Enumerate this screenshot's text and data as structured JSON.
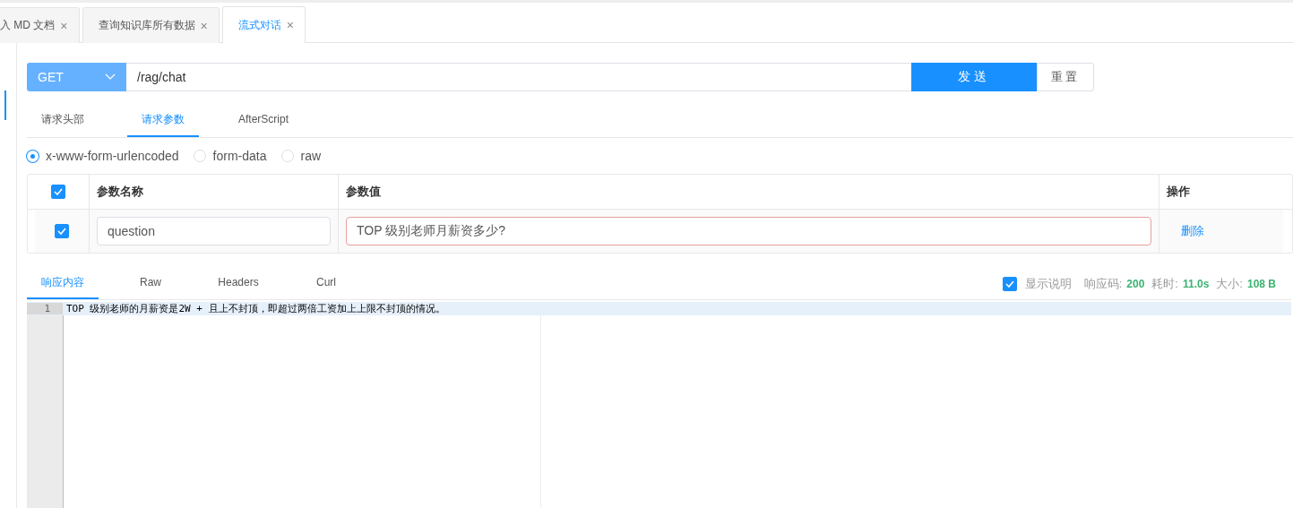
{
  "tabs": [
    {
      "label": "入 MD 文档",
      "close": "×",
      "selected": false
    },
    {
      "label": "查询知识库所有数据",
      "close": "×",
      "selected": false
    },
    {
      "label": "流式对话",
      "close": "×",
      "selected": true
    }
  ],
  "request": {
    "method": "GET",
    "url": "/rag/chat",
    "send": "发送",
    "reset": "重置"
  },
  "request_tabs": [
    {
      "label": "请求头部",
      "selected": false
    },
    {
      "label": "请求参数",
      "selected": true
    },
    {
      "label": "AfterScript",
      "selected": false
    }
  ],
  "body_types": [
    {
      "label": "x-www-form-urlencoded",
      "selected": true
    },
    {
      "label": "form-data",
      "selected": false
    },
    {
      "label": "raw",
      "selected": false
    }
  ],
  "params_table": {
    "header_checked": true,
    "columns": [
      "参数名称",
      "参数值",
      "操作"
    ],
    "rows": [
      {
        "checked": true,
        "name": "question",
        "value": "TOP 级别老师月薪资多少?",
        "action": "删除"
      }
    ]
  },
  "response_tabs": [
    {
      "label": "响应内容",
      "selected": true
    },
    {
      "label": "Raw",
      "selected": false
    },
    {
      "label": "Headers",
      "selected": false
    },
    {
      "label": "Curl",
      "selected": false
    }
  ],
  "show_description": {
    "label": "显示说明",
    "checked": true
  },
  "stats": [
    {
      "label": "响应码:",
      "value": "200"
    },
    {
      "label": "耗时:",
      "value": "11.0s"
    },
    {
      "label": "大小:",
      "value": "108 B"
    }
  ],
  "editor": {
    "lines": [
      {
        "number": "1",
        "text": "TOP 级别老师的月薪资是2W + 且上不封顶，即超过两倍工资加上上限不封顶的情况。"
      }
    ]
  }
}
